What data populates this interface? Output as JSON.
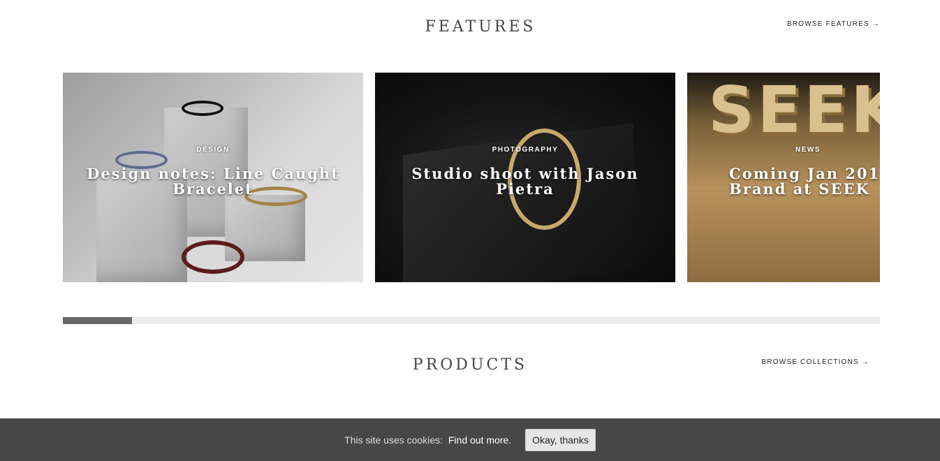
{
  "features": {
    "title": "FEATURES",
    "browse_label": "BROWSE FEATURES →",
    "cards": [
      {
        "category": "DESIGN",
        "title": "Design notes: Line Caught Bracelet"
      },
      {
        "category": "PHOTOGRAPHY",
        "title": "Studio shoot with Jason Pietra"
      },
      {
        "category": "NEWS",
        "title": "Coming Jan 201\nBrand at SEEK"
      }
    ],
    "scroll_progress": 0.085
  },
  "products": {
    "title": "PRODUCTS",
    "browse_label": "BROWSE COLLECTIONS →"
  },
  "cookie_bar": {
    "text": "This site uses cookies:",
    "link_label": "Find out more.",
    "button_label": "Okay, thanks"
  },
  "scene": {
    "sign_text": "SEEK"
  }
}
